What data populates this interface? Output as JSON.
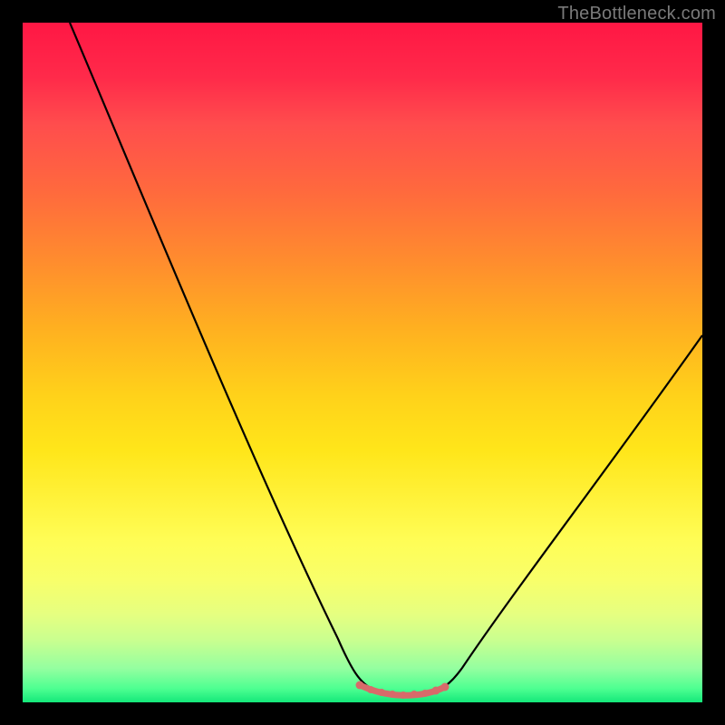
{
  "watermark": "TheBottleneck.com",
  "chart_data": {
    "type": "line",
    "title": "",
    "xlabel": "",
    "ylabel": "",
    "xlim": [
      0,
      100
    ],
    "ylim": [
      0,
      100
    ],
    "grid": false,
    "series": [
      {
        "name": "bottleneck-curve",
        "x": [
          0,
          5,
          10,
          15,
          20,
          25,
          30,
          35,
          40,
          45,
          48,
          50,
          52,
          55,
          58,
          60,
          62,
          65,
          70,
          75,
          80,
          85,
          90,
          95,
          100
        ],
        "y": [
          100,
          91,
          82,
          73,
          64,
          55,
          46,
          37,
          28,
          17,
          8,
          4,
          2,
          1,
          1,
          2,
          3,
          5,
          10,
          18,
          27,
          36,
          45,
          54,
          60
        ]
      }
    ],
    "optimum_marker": {
      "x_range": [
        49,
        62
      ],
      "y": 1.5,
      "color": "#d86a6a"
    },
    "background_gradient": {
      "stops": [
        {
          "pos": 0,
          "color": "#ff1744"
        },
        {
          "pos": 50,
          "color": "#ffd21a"
        },
        {
          "pos": 80,
          "color": "#fffd55"
        },
        {
          "pos": 100,
          "color": "#14e87a"
        }
      ]
    }
  }
}
